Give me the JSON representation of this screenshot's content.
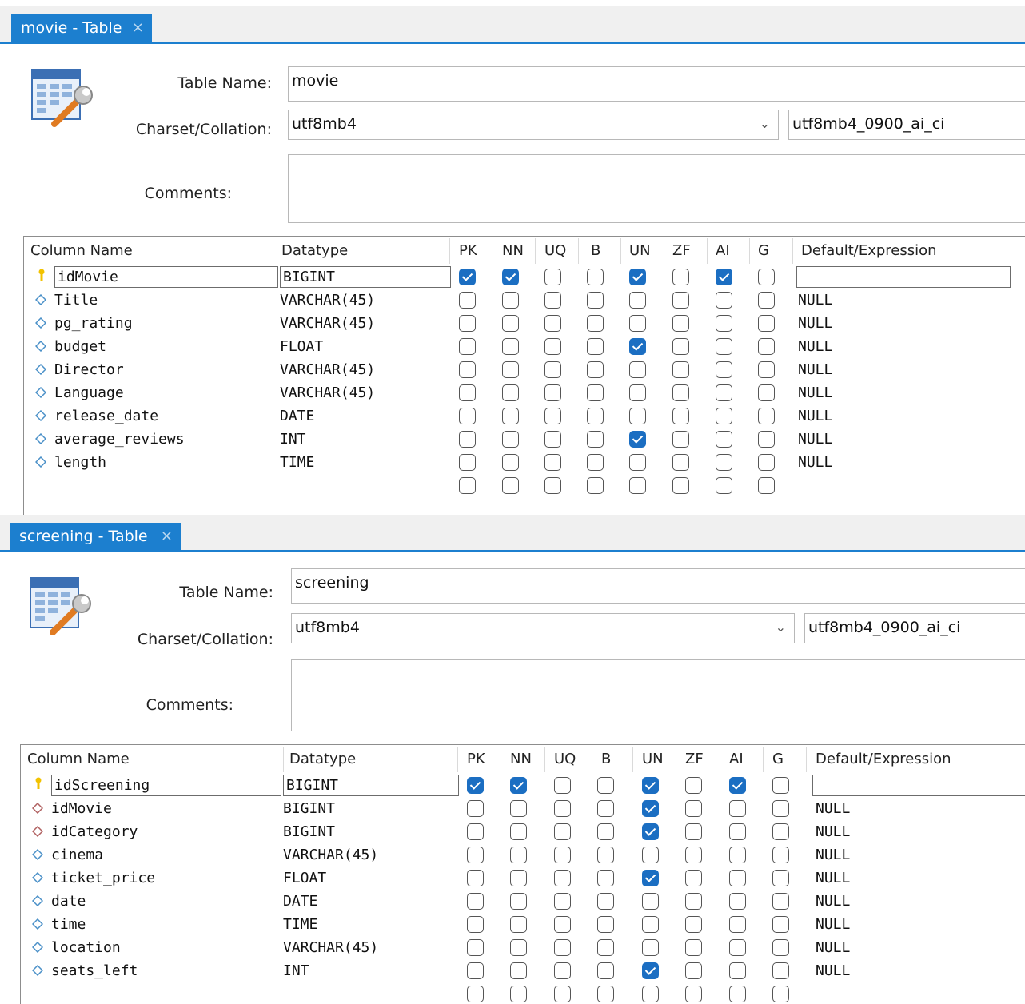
{
  "labels": {
    "table_name": "Table Name:",
    "charset": "Charset/Collation:",
    "comments": "Comments:"
  },
  "columns_header": [
    "Column Name",
    "Datatype",
    "PK",
    "NN",
    "UQ",
    "B",
    "UN",
    "ZF",
    "AI",
    "G",
    "Default/Expression"
  ],
  "colors": {
    "accent": "#1c7fcf",
    "check": "#1b6ec2",
    "pk_key": "#f2c200",
    "col_diamond": "#4a90c8",
    "fk_diamond": "#b06060"
  },
  "panels": [
    {
      "tab_title": "movie - Table",
      "close_glyph": "×",
      "table_name": "movie",
      "charset": "utf8mb4",
      "collation": "utf8mb4_0900_ai_ci",
      "comments": "",
      "rows": [
        {
          "name": "idMovie",
          "type": "BIGINT",
          "flags": [
            1,
            1,
            0,
            0,
            1,
            0,
            1,
            0
          ],
          "default": "",
          "icon": "pk"
        },
        {
          "name": "Title",
          "type": "VARCHAR(45)",
          "flags": [
            0,
            0,
            0,
            0,
            0,
            0,
            0,
            0
          ],
          "default": "NULL",
          "icon": "col"
        },
        {
          "name": "pg_rating",
          "type": "VARCHAR(45)",
          "flags": [
            0,
            0,
            0,
            0,
            0,
            0,
            0,
            0
          ],
          "default": "NULL",
          "icon": "col"
        },
        {
          "name": "budget",
          "type": "FLOAT",
          "flags": [
            0,
            0,
            0,
            0,
            1,
            0,
            0,
            0
          ],
          "default": "NULL",
          "icon": "col"
        },
        {
          "name": "Director",
          "type": "VARCHAR(45)",
          "flags": [
            0,
            0,
            0,
            0,
            0,
            0,
            0,
            0
          ],
          "default": "NULL",
          "icon": "col"
        },
        {
          "name": "Language",
          "type": "VARCHAR(45)",
          "flags": [
            0,
            0,
            0,
            0,
            0,
            0,
            0,
            0
          ],
          "default": "NULL",
          "icon": "col"
        },
        {
          "name": "release_date",
          "type": "DATE",
          "flags": [
            0,
            0,
            0,
            0,
            0,
            0,
            0,
            0
          ],
          "default": "NULL",
          "icon": "col"
        },
        {
          "name": "average_reviews",
          "type": "INT",
          "flags": [
            0,
            0,
            0,
            0,
            1,
            0,
            0,
            0
          ],
          "default": "NULL",
          "icon": "col"
        },
        {
          "name": "length",
          "type": "TIME",
          "flags": [
            0,
            0,
            0,
            0,
            0,
            0,
            0,
            0
          ],
          "default": "NULL",
          "icon": "col"
        },
        {
          "name": "",
          "type": "",
          "flags": [
            0,
            0,
            0,
            0,
            0,
            0,
            0,
            0
          ],
          "default": "",
          "icon": "none"
        }
      ]
    },
    {
      "tab_title": "screening - Table",
      "close_glyph": "×",
      "table_name": "screening",
      "charset": "utf8mb4",
      "collation": "utf8mb4_0900_ai_ci",
      "comments": "",
      "rows": [
        {
          "name": "idScreening",
          "type": "BIGINT",
          "flags": [
            1,
            1,
            0,
            0,
            1,
            0,
            1,
            0
          ],
          "default": "",
          "icon": "pk"
        },
        {
          "name": "idMovie",
          "type": "BIGINT",
          "flags": [
            0,
            0,
            0,
            0,
            1,
            0,
            0,
            0
          ],
          "default": "NULL",
          "icon": "fk"
        },
        {
          "name": "idCategory",
          "type": "BIGINT",
          "flags": [
            0,
            0,
            0,
            0,
            1,
            0,
            0,
            0
          ],
          "default": "NULL",
          "icon": "fk"
        },
        {
          "name": "cinema",
          "type": "VARCHAR(45)",
          "flags": [
            0,
            0,
            0,
            0,
            0,
            0,
            0,
            0
          ],
          "default": "NULL",
          "icon": "col"
        },
        {
          "name": "ticket_price",
          "type": "FLOAT",
          "flags": [
            0,
            0,
            0,
            0,
            1,
            0,
            0,
            0
          ],
          "default": "NULL",
          "icon": "col"
        },
        {
          "name": "date",
          "type": "DATE",
          "flags": [
            0,
            0,
            0,
            0,
            0,
            0,
            0,
            0
          ],
          "default": "NULL",
          "icon": "col"
        },
        {
          "name": "time",
          "type": "TIME",
          "flags": [
            0,
            0,
            0,
            0,
            0,
            0,
            0,
            0
          ],
          "default": "NULL",
          "icon": "col"
        },
        {
          "name": "location",
          "type": "VARCHAR(45)",
          "flags": [
            0,
            0,
            0,
            0,
            0,
            0,
            0,
            0
          ],
          "default": "NULL",
          "icon": "col"
        },
        {
          "name": "seats_left",
          "type": "INT",
          "flags": [
            0,
            0,
            0,
            0,
            1,
            0,
            0,
            0
          ],
          "default": "NULL",
          "icon": "col"
        },
        {
          "name": "",
          "type": "",
          "flags": [
            0,
            0,
            0,
            0,
            0,
            0,
            0,
            0
          ],
          "default": "",
          "icon": "none"
        }
      ]
    }
  ]
}
